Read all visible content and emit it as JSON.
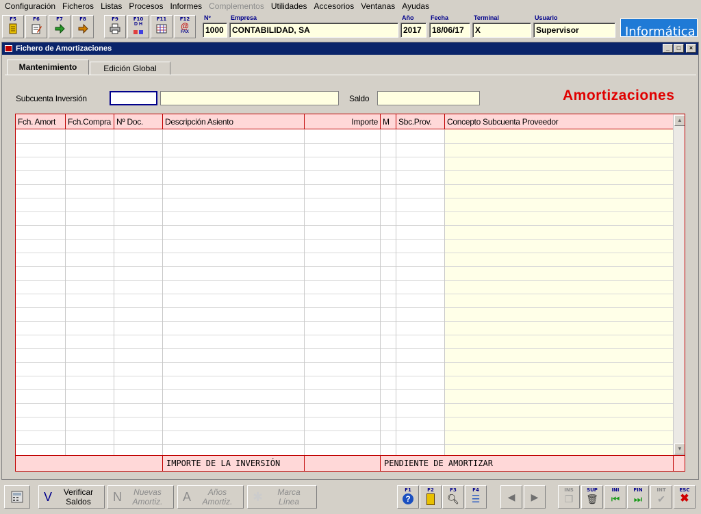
{
  "menu": [
    "Configuración",
    "Ficheros",
    "Listas",
    "Procesos",
    "Informes",
    "Complementos",
    "Utilidades",
    "Accesorios",
    "Ventanas",
    "Ayudas"
  ],
  "toolbar": {
    "f5": "F5",
    "f6": "F6",
    "f7": "F7",
    "f8": "F8",
    "f9": "F9",
    "f10": "F10",
    "f11": "F11",
    "f12": "F12",
    "f10_sub": "D H",
    "f12_sub": "FAX"
  },
  "header": {
    "num_label": "Nº",
    "num_value": "1000",
    "empresa_label": "Empresa",
    "empresa_value": "CONTABILIDAD, SA",
    "anio_label": "Año",
    "anio_value": "2017",
    "fecha_label": "Fecha",
    "fecha_value": "18/06/17",
    "terminal_label": "Terminal",
    "terminal_value": "X",
    "usuario_label": "Usuario",
    "usuario_value": "Supervisor",
    "logo": "Informática"
  },
  "window": {
    "title": "Fichero de Amortizaciones",
    "tabs": [
      "Mantenimiento",
      "Edición Global"
    ],
    "subcuenta_label": "Subcuenta Inversión",
    "saldo_label": "Saldo",
    "big_title": "Amortizaciones"
  },
  "grid": {
    "columns": [
      "Fch. Amort",
      "Fch.Compra",
      "Nº Doc.",
      "Descripción Asiento",
      "Importe",
      "M",
      "Sbc.Prov.",
      "Concepto Subcuenta Proveedor"
    ],
    "footer_inversion": "IMPORTE DE LA INVERSIÓN",
    "footer_pendiente": "PENDIENTE DE AMORTIZAR"
  },
  "bottom": {
    "verificar_letter": "V",
    "verificar_line1": "Verificar",
    "verificar_line2": "Saldos",
    "nuevas_letter": "N",
    "nuevas_line1": "Nuevas",
    "nuevas_line2": "Amortiz.",
    "anios_letter": "A",
    "anios_line1": "Años",
    "anios_line2": "Amortiz.",
    "marca_line1": "Marca",
    "marca_line2": "Línea",
    "f1": "F1",
    "f2": "F2",
    "f3": "F3",
    "f4": "F4",
    "ins": "INS",
    "sup": "SUP",
    "ini": "INI",
    "fin": "FIN",
    "int": "INT",
    "esc": "ESC"
  }
}
